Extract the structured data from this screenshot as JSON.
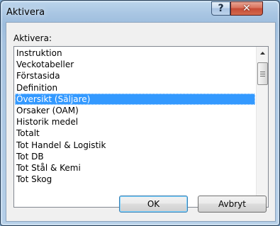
{
  "window": {
    "title": "Aktivera"
  },
  "titlebar": {
    "help_glyph": "?",
    "close_glyph": "✕"
  },
  "dialog": {
    "label": "Aktivera:",
    "items": [
      "Instruktion",
      "Veckotabeller",
      "Förstasida",
      "Definition",
      "Översikt (Säljare)",
      "Orsaker (OAM)",
      "Historik medel",
      "Totalt",
      "Tot Handel & Logistik",
      "Tot DB",
      "Tot Stål & Kemi",
      "Tot Skog"
    ],
    "selected_index": 4,
    "ok_label": "OK",
    "cancel_label": "Avbryt"
  },
  "colors": {
    "selection": "#3399ff",
    "close_button": "#c74b35",
    "frame": "#a9c6e3"
  },
  "icons": {
    "help": "question-mark-icon",
    "close": "close-icon",
    "scroll_up": "triangle-up-icon",
    "scroll_down": "triangle-down-icon",
    "grip": "grip-lines-icon"
  }
}
